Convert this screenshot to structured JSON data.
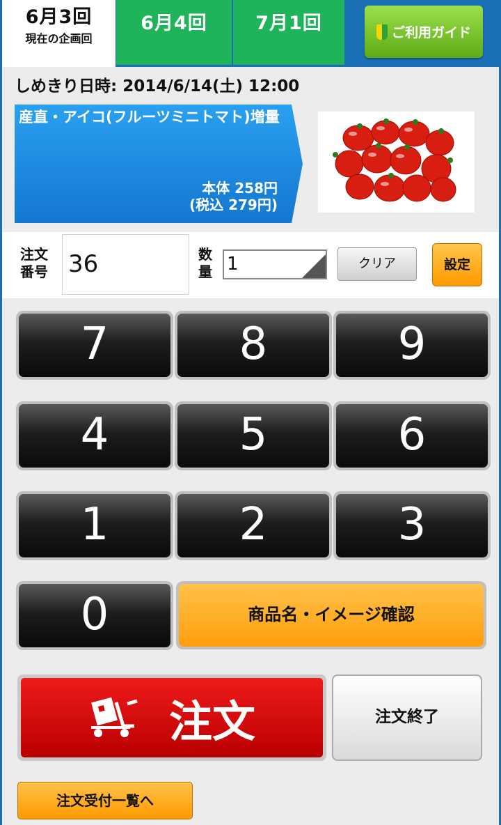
{
  "tabs": {
    "current": {
      "title": "6月3回",
      "subtitle": "現在の企画回"
    },
    "others": [
      "6月4回",
      "7月1回"
    ],
    "guide_label": "ご利用ガイド"
  },
  "deadline": "しめきり日時: 2014/6/14(土) 12:00",
  "product": {
    "name": "産直・アイコ(フルーツミニトマト)増量",
    "price_body": "本体 258円",
    "price_tax": "(税込 279円)",
    "image": "cherry-tomatoes"
  },
  "order": {
    "number_label": "注文番号",
    "number_value": "36",
    "qty_label": "数量",
    "qty_value": "1",
    "clear_label": "クリア",
    "set_label": "設定"
  },
  "keypad": {
    "keys": [
      "7",
      "8",
      "9",
      "4",
      "5",
      "6",
      "1",
      "2",
      "3",
      "0"
    ],
    "confirm_label": "商品名・イメージ確認"
  },
  "actions": {
    "order_label": "注文",
    "end_label": "注文終了",
    "list_label": "注文受付一覧へ"
  },
  "colors": {
    "tab_green": "#1fb35a",
    "frame_blue": "#1a6fb5",
    "order_red": "#d40000",
    "accent_orange": "#ffa500",
    "guide_green": "#7cc832"
  }
}
